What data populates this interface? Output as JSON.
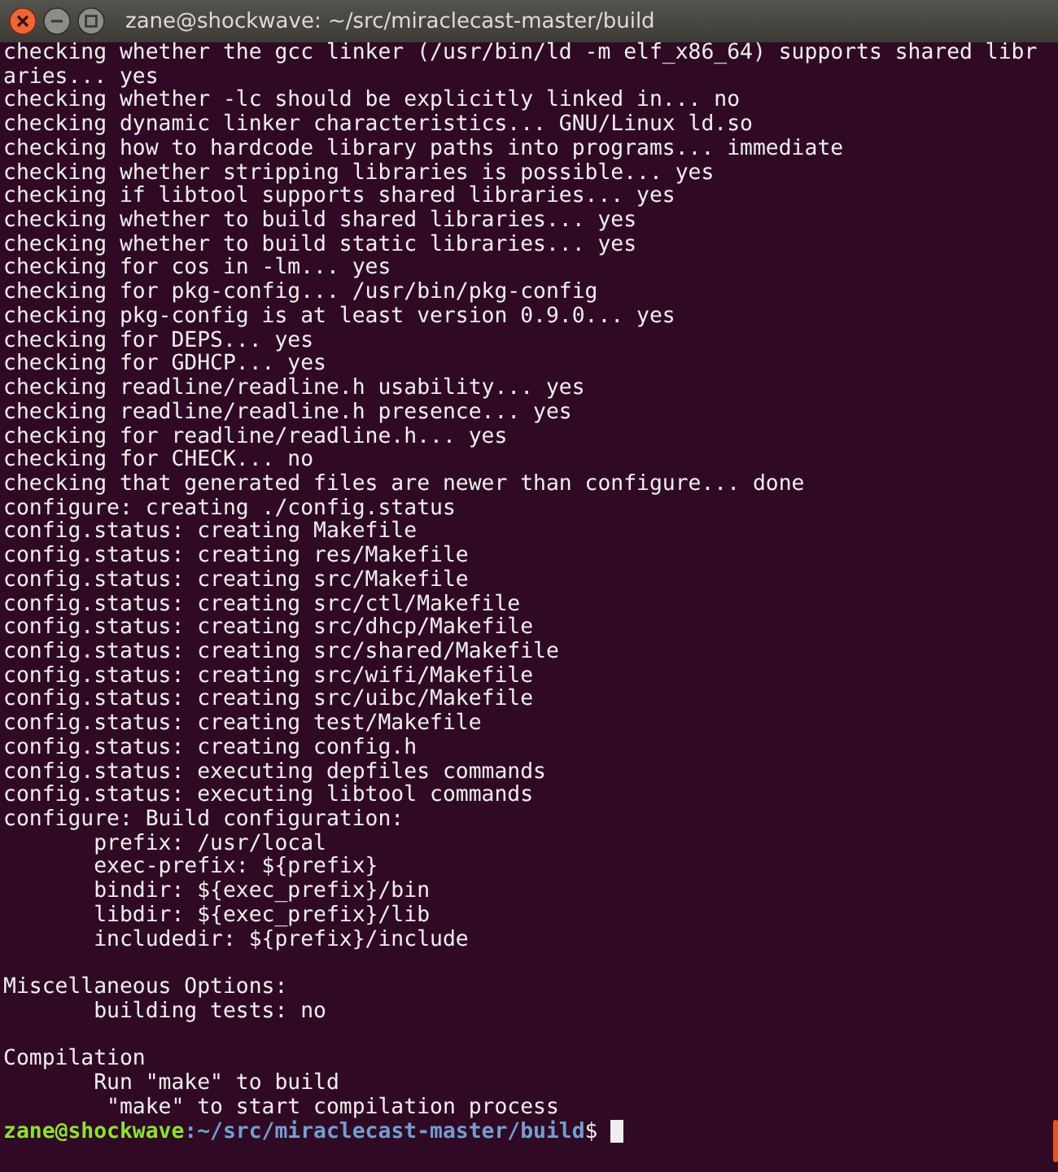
{
  "window": {
    "title": "zane@shockwave: ~/src/miraclecast-master/build"
  },
  "terminal": {
    "lines": [
      {
        "kind": "output",
        "text": "checking whether the gcc linker (/usr/bin/ld -m elf_x86_64) supports shared libr"
      },
      {
        "kind": "output",
        "text": "aries... yes"
      },
      {
        "kind": "output",
        "text": "checking whether -lc should be explicitly linked in... no"
      },
      {
        "kind": "output",
        "text": "checking dynamic linker characteristics... GNU/Linux ld.so"
      },
      {
        "kind": "output",
        "text": "checking how to hardcode library paths into programs... immediate"
      },
      {
        "kind": "output",
        "text": "checking whether stripping libraries is possible... yes"
      },
      {
        "kind": "output",
        "text": "checking if libtool supports shared libraries... yes"
      },
      {
        "kind": "output",
        "text": "checking whether to build shared libraries... yes"
      },
      {
        "kind": "output",
        "text": "checking whether to build static libraries... yes"
      },
      {
        "kind": "output",
        "text": "checking for cos in -lm... yes"
      },
      {
        "kind": "output",
        "text": "checking for pkg-config... /usr/bin/pkg-config"
      },
      {
        "kind": "output",
        "text": "checking pkg-config is at least version 0.9.0... yes"
      },
      {
        "kind": "output",
        "text": "checking for DEPS... yes"
      },
      {
        "kind": "output",
        "text": "checking for GDHCP... yes"
      },
      {
        "kind": "output",
        "text": "checking readline/readline.h usability... yes"
      },
      {
        "kind": "output",
        "text": "checking readline/readline.h presence... yes"
      },
      {
        "kind": "output",
        "text": "checking for readline/readline.h... yes"
      },
      {
        "kind": "output",
        "text": "checking for CHECK... no"
      },
      {
        "kind": "output",
        "text": "checking that generated files are newer than configure... done"
      },
      {
        "kind": "output",
        "text": "configure: creating ./config.status"
      },
      {
        "kind": "output",
        "text": "config.status: creating Makefile"
      },
      {
        "kind": "output",
        "text": "config.status: creating res/Makefile"
      },
      {
        "kind": "output",
        "text": "config.status: creating src/Makefile"
      },
      {
        "kind": "output",
        "text": "config.status: creating src/ctl/Makefile"
      },
      {
        "kind": "output",
        "text": "config.status: creating src/dhcp/Makefile"
      },
      {
        "kind": "output",
        "text": "config.status: creating src/shared/Makefile"
      },
      {
        "kind": "output",
        "text": "config.status: creating src/wifi/Makefile"
      },
      {
        "kind": "output",
        "text": "config.status: creating src/uibc/Makefile"
      },
      {
        "kind": "output",
        "text": "config.status: creating test/Makefile"
      },
      {
        "kind": "output",
        "text": "config.status: creating config.h"
      },
      {
        "kind": "output",
        "text": "config.status: executing depfiles commands"
      },
      {
        "kind": "output",
        "text": "config.status: executing libtool commands"
      },
      {
        "kind": "output",
        "text": "configure: Build configuration:"
      },
      {
        "kind": "output",
        "text": "       prefix: /usr/local"
      },
      {
        "kind": "output",
        "text": "       exec-prefix: ${prefix}"
      },
      {
        "kind": "output",
        "text": "       bindir: ${exec_prefix}/bin"
      },
      {
        "kind": "output",
        "text": "       libdir: ${exec_prefix}/lib"
      },
      {
        "kind": "output",
        "text": "       includedir: ${prefix}/include"
      },
      {
        "kind": "blank"
      },
      {
        "kind": "output",
        "text": "Miscellaneous Options:"
      },
      {
        "kind": "output",
        "text": "       building tests: no"
      },
      {
        "kind": "blank"
      },
      {
        "kind": "output",
        "text": "Compilation"
      },
      {
        "kind": "output",
        "text": "       Run \"make\" to build"
      },
      {
        "kind": "output",
        "text": "        \"make\" to start compilation process"
      }
    ],
    "prompt": {
      "user": "zane@shockwave",
      "path": ":~/src/miraclecast-master/build",
      "symbol": "$ "
    }
  }
}
